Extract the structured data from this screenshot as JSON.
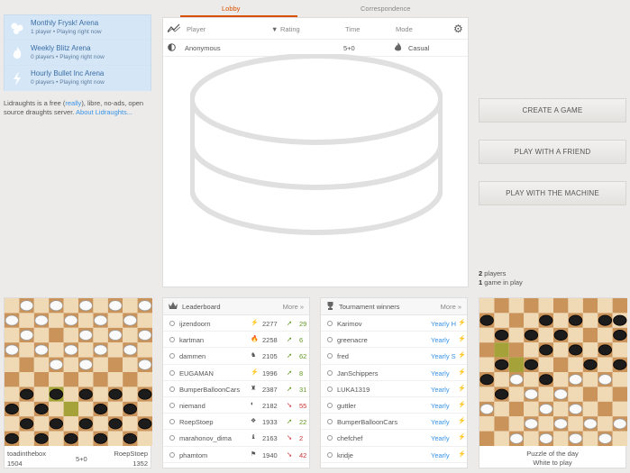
{
  "tournaments": [
    {
      "name": "Monthly Frysk! Arena",
      "sub": "1 player • Playing right now",
      "icon": "frysk-icon"
    },
    {
      "name": "Weekly Blitz Arena",
      "sub": "0 players • Playing right now",
      "icon": "blitz-fire-icon"
    },
    {
      "name": "Hourly Bullet Inc Arena",
      "sub": "0 players • Playing right now",
      "icon": "bullet-icon"
    }
  ],
  "about": {
    "text1": "Lidraughts is a free (",
    "really": "really",
    "text2": "), libre, no-ads, open source draughts server. ",
    "link": "About Lidraughts..."
  },
  "tabs": {
    "lobby": "Lobby",
    "correspondence": "Correspondence"
  },
  "lobby": {
    "headers": {
      "player": "Player",
      "rating": "Rating",
      "time": "Time",
      "mode": "Mode"
    },
    "rows": [
      {
        "player": "Anonymous",
        "rating": "",
        "time": "5+0",
        "mode": "Casual"
      }
    ]
  },
  "buttons": {
    "create": "CREATE A GAME",
    "friend": "PLAY WITH A FRIEND",
    "machine": "PLAY WITH THE MACHINE"
  },
  "counts": {
    "players_num": "2",
    "players_label": " players",
    "games_num": "1",
    "games_label": " game in play"
  },
  "leaderboard": {
    "title": "Leaderboard",
    "more": "More »",
    "rows": [
      {
        "name": "ijzendoorn",
        "rating": "2277",
        "delta": "29",
        "dir": "up"
      },
      {
        "name": "kartman",
        "rating": "2258",
        "delta": "6",
        "dir": "up"
      },
      {
        "name": "dammen",
        "rating": "2105",
        "delta": "62",
        "dir": "up"
      },
      {
        "name": "EUGAMAN",
        "rating": "1996",
        "delta": "8",
        "dir": "up"
      },
      {
        "name": "BumperBalloonCars",
        "rating": "2387",
        "delta": "31",
        "dir": "up"
      },
      {
        "name": "niemand",
        "rating": "2182",
        "delta": "55",
        "dir": "down"
      },
      {
        "name": "RoepStoep",
        "rating": "1933",
        "delta": "22",
        "dir": "up"
      },
      {
        "name": "marahonov_dima",
        "rating": "2163",
        "delta": "2",
        "dir": "down"
      },
      {
        "name": "phamtom",
        "rating": "1940",
        "delta": "42",
        "dir": "down"
      }
    ]
  },
  "winners": {
    "title": "Tournament winners",
    "more": "More »",
    "rows": [
      {
        "name": "Karimov",
        "label": "Yearly H"
      },
      {
        "name": "greenacre",
        "label": "Yearly"
      },
      {
        "name": "fred",
        "label": "Yearly S"
      },
      {
        "name": "JanSchippers",
        "label": "Yearly"
      },
      {
        "name": "LUKA1319",
        "label": "Yearly"
      },
      {
        "name": "guttler",
        "label": "Yearly"
      },
      {
        "name": "BumperBalloonCars",
        "label": "Yearly"
      },
      {
        "name": "chefchef",
        "label": "Yearly"
      },
      {
        "name": "kridje",
        "label": "Yearly"
      }
    ]
  },
  "tv": {
    "white": "toadinthebox",
    "white_rating": "1504",
    "clock": "5+0",
    "black": "RoepStoep",
    "black_rating": "1352"
  },
  "puzzle": {
    "title": "Puzzle of the day",
    "sub": "White to play"
  },
  "colors": {
    "accent": "#d85000",
    "link": "#3893e8",
    "up": "#629924",
    "down": "#cc3333"
  }
}
